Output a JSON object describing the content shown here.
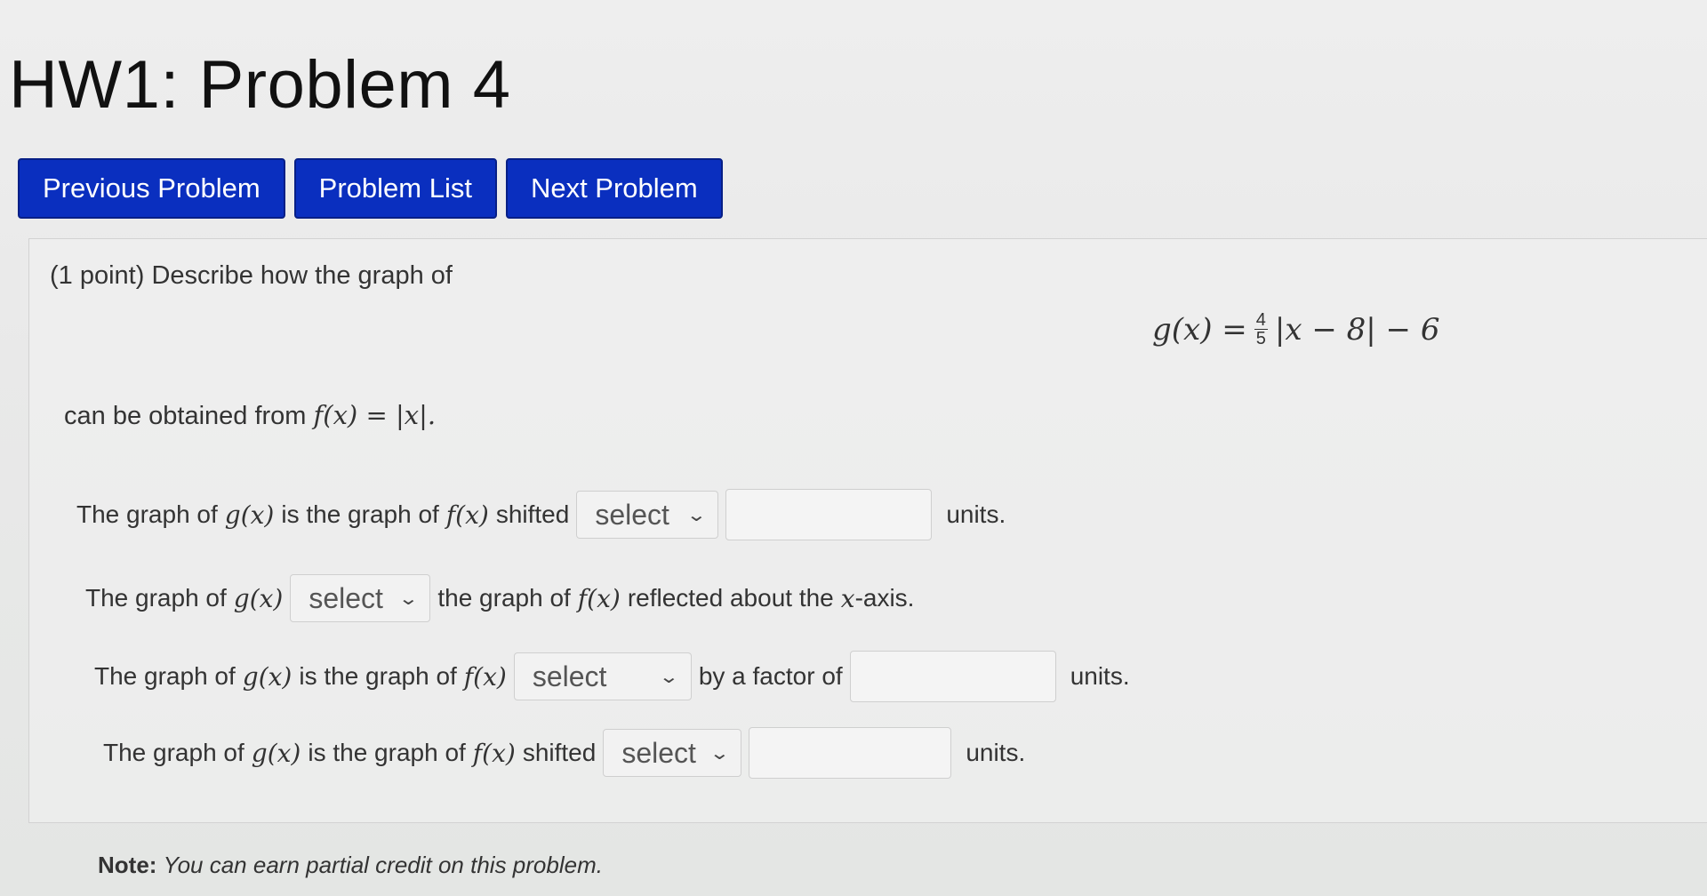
{
  "title": "HW1: Problem 4",
  "nav": {
    "previous": "Previous Problem",
    "list": "Problem List",
    "next": "Next Problem"
  },
  "problem": {
    "intro": "(1 point) Describe how the graph of",
    "g_lhs": "g(x) =",
    "frac_num": "4",
    "frac_den": "5",
    "g_rhs": "|x − 8| − 6",
    "obtained_prefix": "can be obtained from",
    "f_def": "f(x) = |x|."
  },
  "rows": [
    {
      "text1": "The graph of",
      "g": "g(x)",
      "text2": "is the graph of",
      "f": "f(x)",
      "text3": "shifted",
      "select_value": "select",
      "suffix": "units."
    },
    {
      "text1": "The graph of",
      "g": "g(x)",
      "select_value": "select",
      "text2": "the graph of",
      "f": "f(x)",
      "text3": "reflected about the",
      "axis": "x",
      "text4": "-axis."
    },
    {
      "text1": "The graph of",
      "g": "g(x)",
      "text2": "is the graph of",
      "f": "f(x)",
      "select_value": "select",
      "text3": "by a factor of",
      "suffix": "units."
    },
    {
      "text1": "The graph of",
      "g": "g(x)",
      "text2": "is the graph of",
      "f": "f(x)",
      "text3": "shifted",
      "select_value": "select",
      "suffix": "units."
    }
  ],
  "note": {
    "label": "Note:",
    "text": "You can earn partial credit on this problem."
  }
}
